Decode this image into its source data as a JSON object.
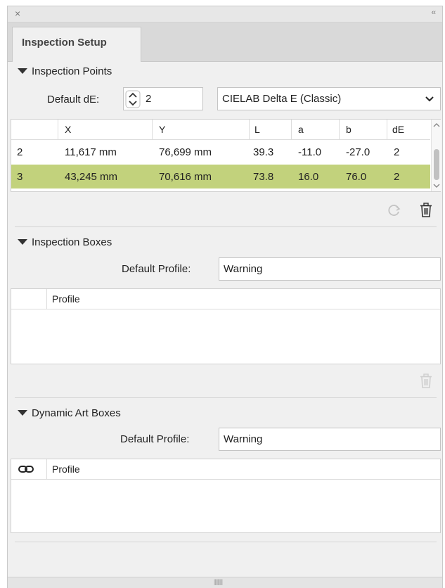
{
  "panel": {
    "close_glyph": "×",
    "collapse_glyph": "‹‹",
    "tab_label": "Inspection Setup",
    "grip_glyph": "|||||||||"
  },
  "inspection_points": {
    "heading": "Inspection Points",
    "default_de_label": "Default dE:",
    "default_de_value": "2",
    "method_selected": "CIELAB Delta E (Classic)",
    "columns": [
      "",
      "X",
      "Y",
      "L",
      "a",
      "b",
      "dE"
    ],
    "rows": [
      {
        "id": "2",
        "x": "11,617 mm",
        "y": "76,699 mm",
        "L": "39.3",
        "a": "-11.0",
        "b": "-27.0",
        "dE": "2",
        "selected": false
      },
      {
        "id": "3",
        "x": "43,245 mm",
        "y": "70,616 mm",
        "L": "73.8",
        "a": "16.0",
        "b": "76.0",
        "dE": "2",
        "selected": true
      }
    ]
  },
  "inspection_boxes": {
    "heading": "Inspection Boxes",
    "default_profile_label": "Default Profile:",
    "default_profile_value": "Warning",
    "column_profile": "Profile"
  },
  "dynamic_art_boxes": {
    "heading": "Dynamic Art Boxes",
    "default_profile_label": "Default Profile:",
    "default_profile_value": "Warning",
    "column_profile": "Profile"
  },
  "colors": {
    "selected_row": "#c2d27c",
    "panel_bg": "#f0f0f0"
  },
  "icons": [
    "close-icon",
    "collapse-icon",
    "disclosure-triangle-icon",
    "stepper-icon",
    "chevron-down-icon",
    "refresh-icon",
    "trash-icon",
    "link-icon",
    "resize-grip-icon"
  ]
}
